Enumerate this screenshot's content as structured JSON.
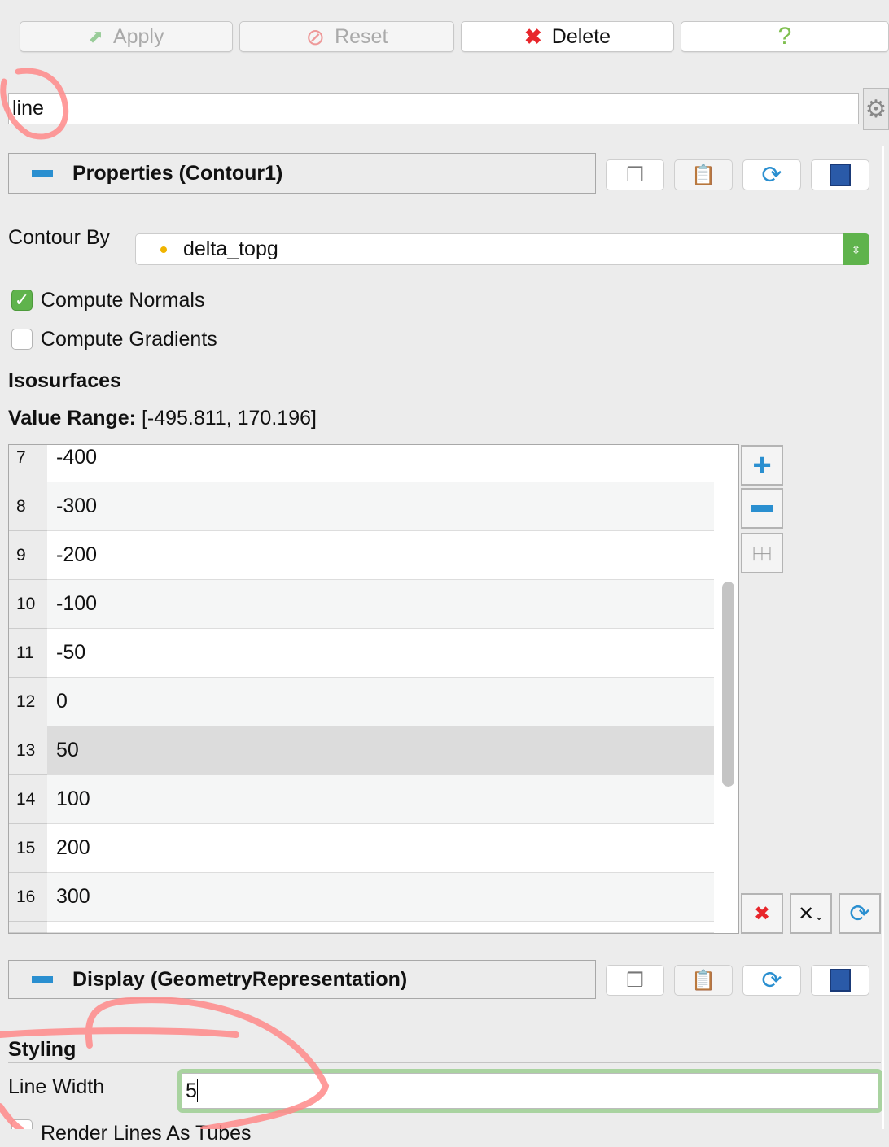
{
  "toolbar": {
    "apply": "Apply",
    "reset": "Reset",
    "delete": "Delete",
    "help": "?"
  },
  "search": {
    "value": "line"
  },
  "properties": {
    "title": "Properties (Contour1)"
  },
  "contour_by": {
    "label": "Contour By",
    "value": "delta_topg"
  },
  "compute_normals": {
    "label": "Compute Normals",
    "checked": true
  },
  "compute_gradients": {
    "label": "Compute Gradients",
    "checked": false
  },
  "isosurfaces": {
    "title": "Isosurfaces",
    "range_label": "Value Range:",
    "range_value": "[-495.811, 170.196]",
    "rows": [
      {
        "i": "7",
        "v": "-400"
      },
      {
        "i": "8",
        "v": "-300"
      },
      {
        "i": "9",
        "v": "-200"
      },
      {
        "i": "10",
        "v": "-100"
      },
      {
        "i": "11",
        "v": "-50"
      },
      {
        "i": "12",
        "v": "0"
      },
      {
        "i": "13",
        "v": "50"
      },
      {
        "i": "14",
        "v": "100"
      },
      {
        "i": "15",
        "v": "200"
      },
      {
        "i": "16",
        "v": "300"
      }
    ],
    "selected_index": "13"
  },
  "display": {
    "title": "Display (GeometryRepresentation)"
  },
  "styling": {
    "title": "Styling",
    "line_width_label": "Line Width",
    "line_width_value": "5",
    "render_tubes_label": "Render Lines As Tubes"
  },
  "colors": {
    "accent": "#2a8fd0",
    "annotation": "#ff8a8a",
    "focus": "#a9d3a0",
    "delete": "#e8262b"
  }
}
